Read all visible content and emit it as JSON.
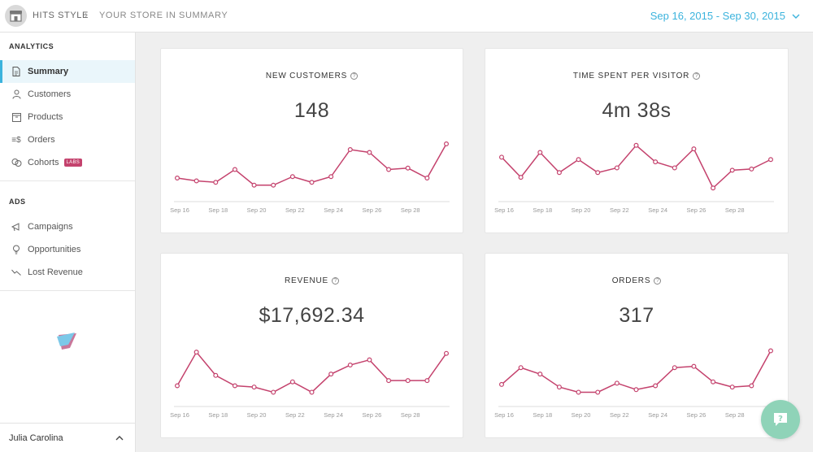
{
  "header": {
    "store_name": "HITS STYLE",
    "separator": "›",
    "breadcrumb": "YOUR STORE IN SUMMARY",
    "date_range": "Sep 16, 2015 - Sep 30, 2015",
    "accent_color": "#3bb3dd"
  },
  "sidebar": {
    "analytics_title": "ANALYTICS",
    "analytics_items": [
      {
        "label": "Summary",
        "icon": "document-icon",
        "active": true
      },
      {
        "label": "Customers",
        "icon": "person-icon"
      },
      {
        "label": "Products",
        "icon": "box-icon"
      },
      {
        "label": "Orders",
        "icon": "dollar-list-icon"
      },
      {
        "label": "Cohorts",
        "icon": "cohorts-icon",
        "badge": "LABS"
      }
    ],
    "ads_title": "ADS",
    "ads_items": [
      {
        "label": "Campaigns",
        "icon": "megaphone-icon"
      },
      {
        "label": "Opportunities",
        "icon": "lightbulb-icon"
      },
      {
        "label": "Lost Revenue",
        "icon": "trend-down-icon"
      }
    ],
    "user_name": "Julia Carolina"
  },
  "cards": [
    {
      "title": "NEW CUSTOMERS",
      "value": "148"
    },
    {
      "title": "TIME SPENT PER VISITOR",
      "value": "4m 38s"
    },
    {
      "title": "REVENUE",
      "value": "$17,692.34"
    },
    {
      "title": "ORDERS",
      "value": "317"
    }
  ],
  "chart_data": [
    {
      "type": "line",
      "title": "NEW CUSTOMERS",
      "x": [
        "Sep 16",
        "Sep 17",
        "Sep 18",
        "Sep 19",
        "Sep 20",
        "Sep 21",
        "Sep 22",
        "Sep 23",
        "Sep 24",
        "Sep 25",
        "Sep 26",
        "Sep 27",
        "Sep 28",
        "Sep 29",
        "Sep 30"
      ],
      "tick_labels": [
        "Sep 16",
        "Sep 18",
        "Sep 20",
        "Sep 22",
        "Sep 24",
        "Sep 26",
        "Sep 28"
      ],
      "values": [
        6,
        5,
        4.5,
        9,
        3.5,
        3.5,
        6.5,
        4.5,
        6.5,
        16,
        15,
        9,
        9.5,
        6,
        18
      ],
      "ylim": [
        0,
        20
      ],
      "color": "#c4426d"
    },
    {
      "type": "line",
      "title": "TIME SPENT PER VISITOR",
      "x": [
        "Sep 16",
        "Sep 17",
        "Sep 18",
        "Sep 19",
        "Sep 20",
        "Sep 21",
        "Sep 22",
        "Sep 23",
        "Sep 24",
        "Sep 25",
        "Sep 26",
        "Sep 27",
        "Sep 28",
        "Sep 29",
        "Sep 30"
      ],
      "tick_labels": [
        "Sep 16",
        "Sep 18",
        "Sep 20",
        "Sep 22",
        "Sep 24",
        "Sep 26",
        "Sep 28"
      ],
      "values": [
        16,
        7.5,
        18,
        9.5,
        15,
        9.5,
        11.5,
        21,
        14,
        11.5,
        19.5,
        3,
        10.5,
        11,
        15
      ],
      "ylim": [
        0,
        24
      ],
      "color": "#c4426d"
    },
    {
      "type": "line",
      "title": "REVENUE",
      "x": [
        "Sep 16",
        "Sep 17",
        "Sep 18",
        "Sep 19",
        "Sep 20",
        "Sep 21",
        "Sep 22",
        "Sep 23",
        "Sep 24",
        "Sep 25",
        "Sep 26",
        "Sep 27",
        "Sep 28",
        "Sep 29",
        "Sep 30"
      ],
      "tick_labels": [
        "Sep 16",
        "Sep 18",
        "Sep 20",
        "Sep 22",
        "Sep 24",
        "Sep 26",
        "Sep 28"
      ],
      "values": [
        5.5,
        18.5,
        9.5,
        5.5,
        5,
        3,
        7,
        3,
        10,
        13.5,
        15.5,
        7.5,
        7.5,
        7.5,
        18
      ],
      "ylim": [
        0,
        22
      ],
      "color": "#c4426d"
    },
    {
      "type": "line",
      "title": "ORDERS",
      "x": [
        "Sep 16",
        "Sep 17",
        "Sep 18",
        "Sep 19",
        "Sep 20",
        "Sep 21",
        "Sep 22",
        "Sep 23",
        "Sep 24",
        "Sep 25",
        "Sep 26",
        "Sep 27",
        "Sep 28",
        "Sep 29",
        "Sep 30"
      ],
      "tick_labels": [
        "Sep 16",
        "Sep 18",
        "Sep 20",
        "Sep 22",
        "Sep 24",
        "Sep 26",
        "Sep 28"
      ],
      "values": [
        6,
        12.5,
        10,
        5,
        3,
        3,
        6.5,
        4,
        5.5,
        12.5,
        13,
        7,
        5,
        5.5,
        19
      ],
      "ylim": [
        0,
        22
      ],
      "color": "#c4426d"
    }
  ]
}
